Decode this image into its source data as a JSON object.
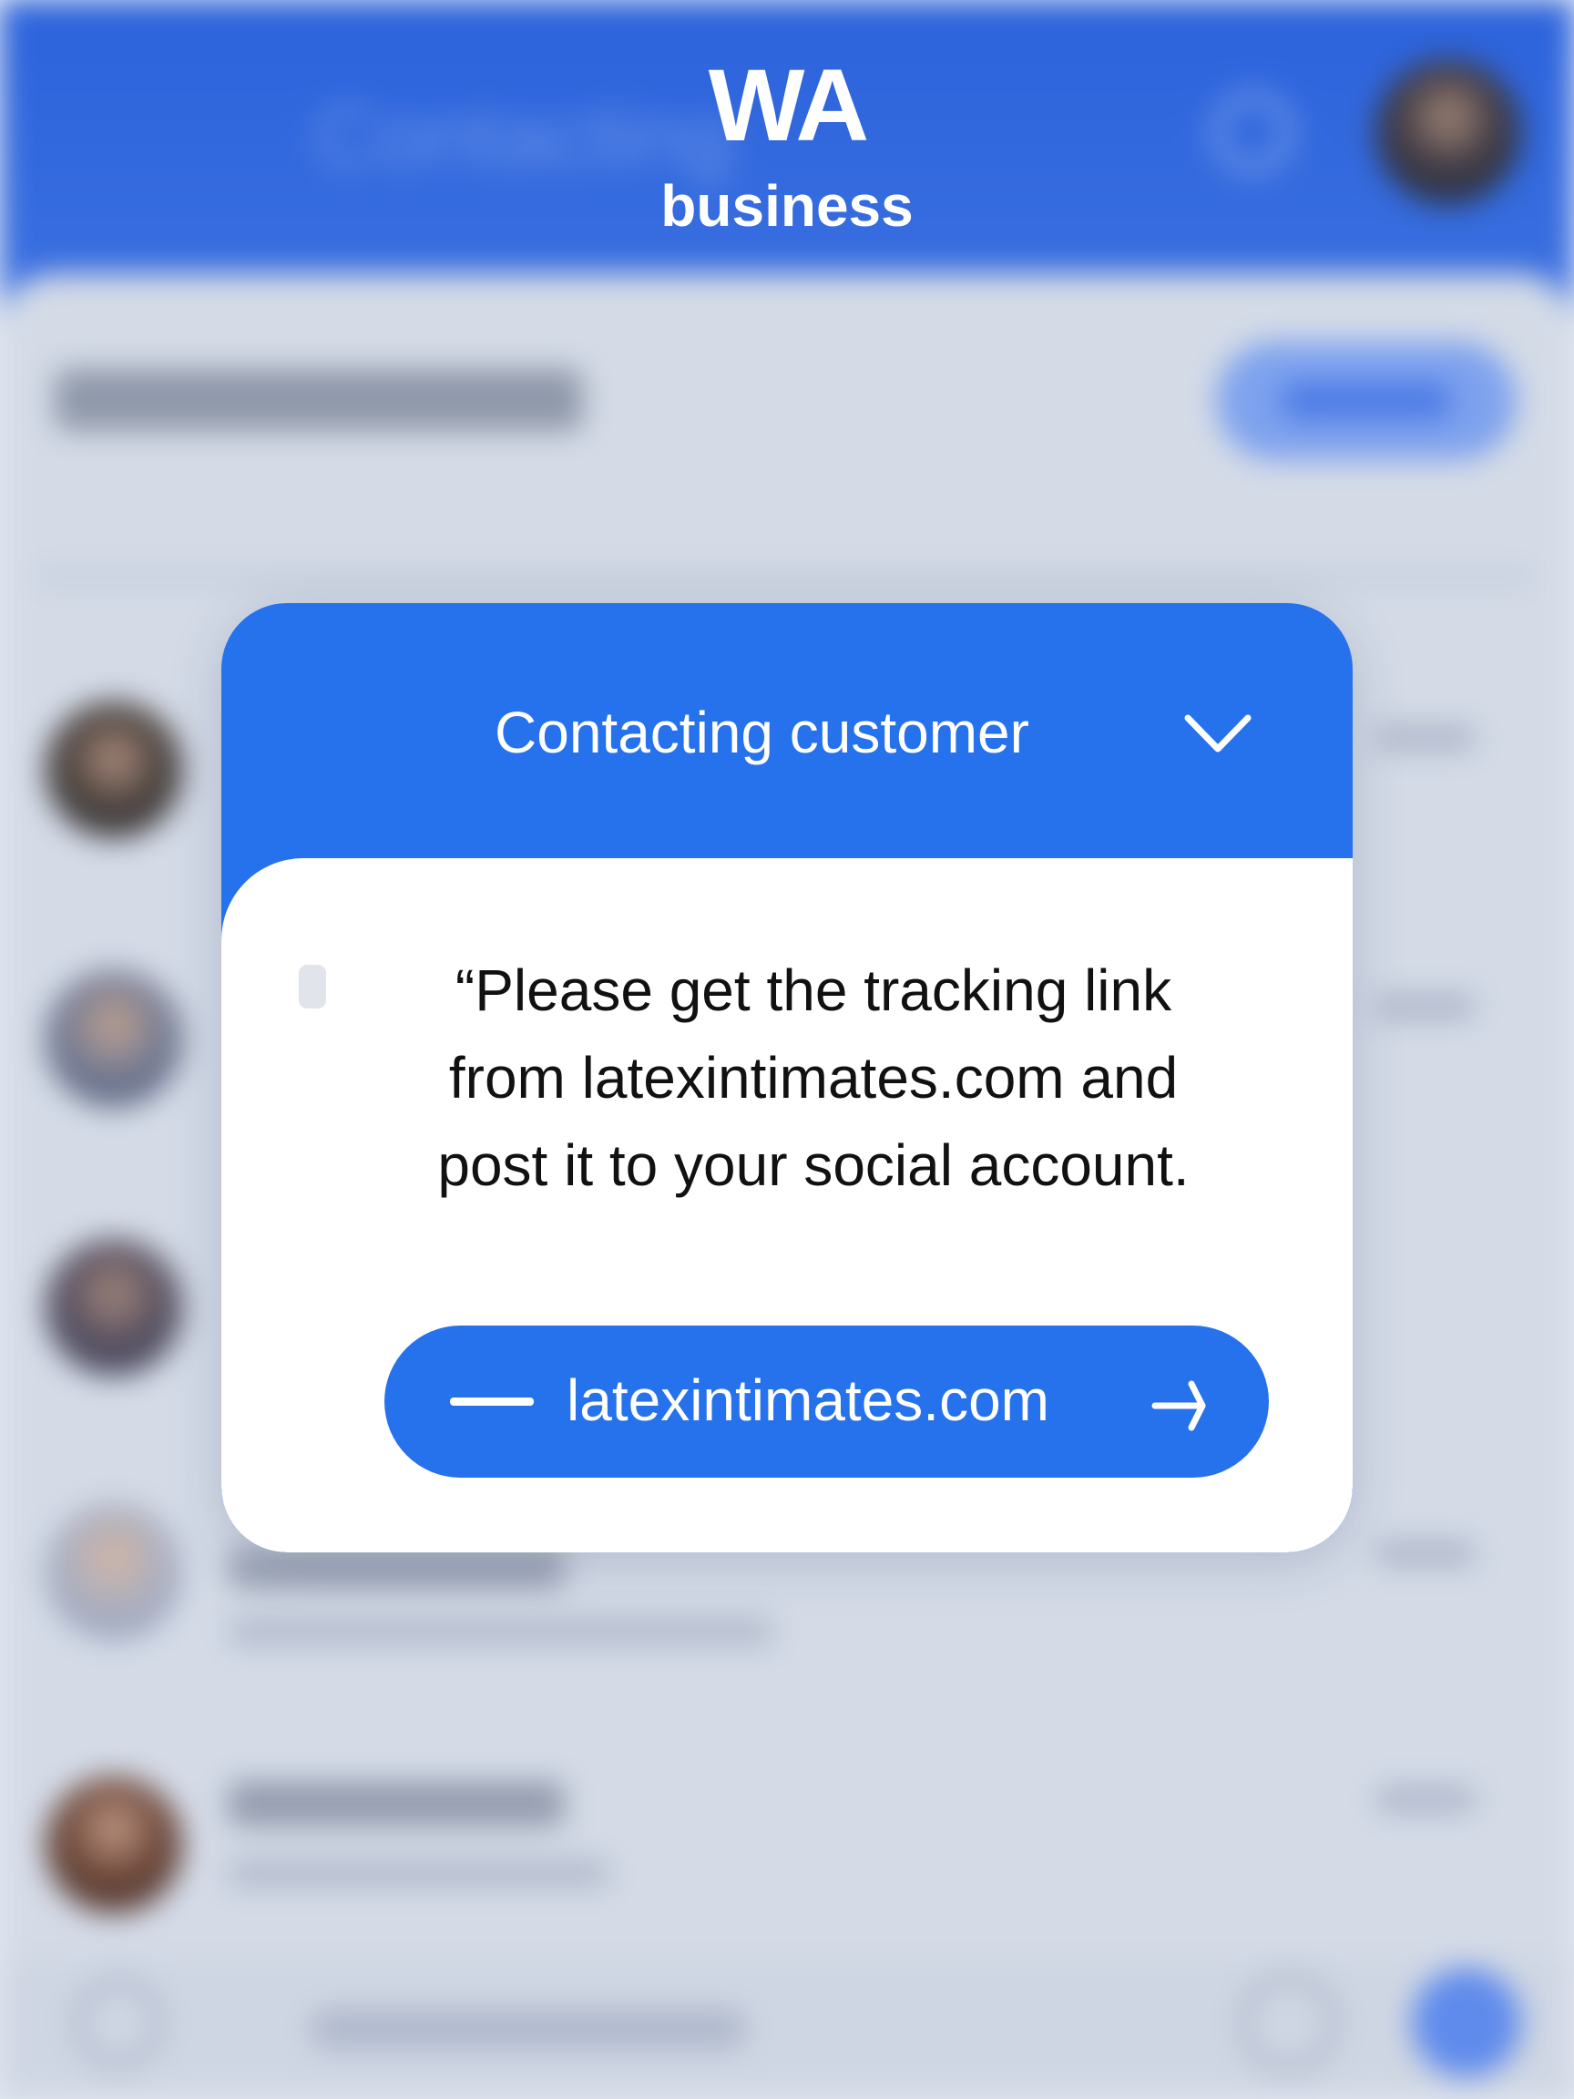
{
  "app": {
    "brand_name": "WA",
    "brand_sub": "business",
    "background_title": "Contacting",
    "accent_color": "#2672ec"
  },
  "card": {
    "title": "Contacting customer",
    "message": "“Please get the tracking link\nfrom latexintimates.com and\npost it to your social account.",
    "link_label": "latexintimates.com",
    "icons": {
      "header": "chevron-down-icon",
      "link_left": "dash-icon",
      "link_right": "arrow-icon"
    }
  }
}
